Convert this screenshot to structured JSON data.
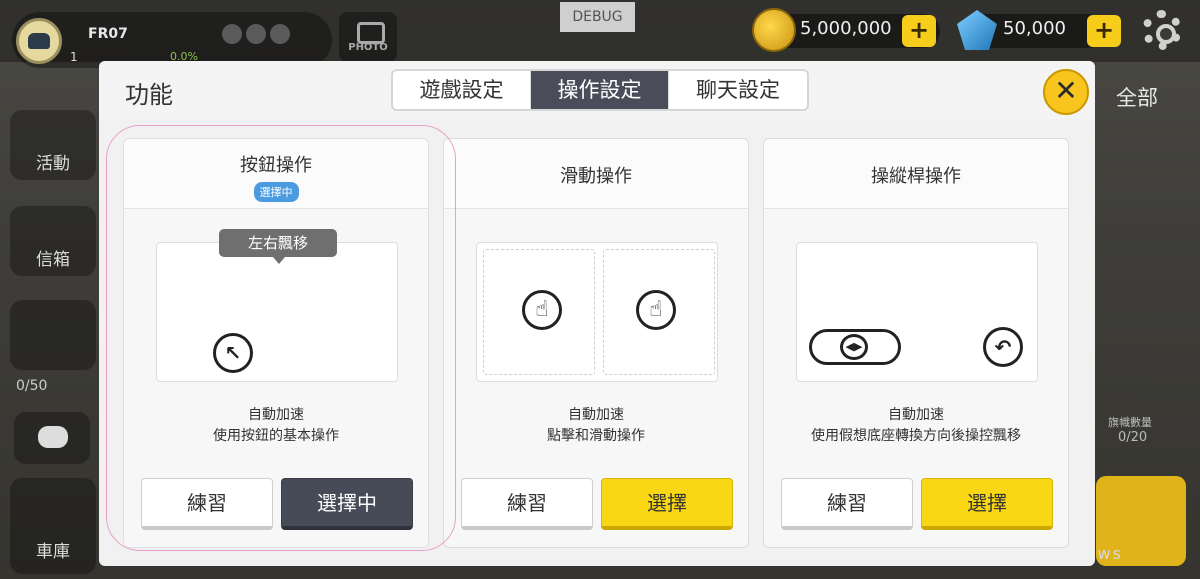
{
  "hud": {
    "player_name": "FR07",
    "level": "1",
    "exp_percent": "0.0%",
    "photo_label": "PHOTO",
    "debug_label": "DEBUG",
    "coins": "5,000,000",
    "gems": "50,000",
    "plus_symbol": "+"
  },
  "sidebar": {
    "items": [
      {
        "label": "活動"
      },
      {
        "label": "信箱"
      }
    ],
    "trophy_count": "0/50",
    "garage_label": "車庫"
  },
  "right_panel": {
    "all_label": "全部",
    "flag_label": "旗幟數量",
    "flag_count": "0/20"
  },
  "watermark": "us news",
  "modal": {
    "title": "功能",
    "tabs": [
      {
        "label": "遊戲設定",
        "active": false
      },
      {
        "label": "操作設定",
        "active": true
      },
      {
        "label": "聊天設定",
        "active": false
      }
    ],
    "close_symbol": "✕",
    "cards": [
      {
        "title": "按鈕操作",
        "badge": "選擇中",
        "tooltip": "左右飄移",
        "desc_line1": "自動加速",
        "desc_line2": "使用按鈕的基本操作",
        "practice_label": "練習",
        "select_label": "選擇中"
      },
      {
        "title": "滑動操作",
        "desc_line1": "自動加速",
        "desc_line2": "點擊和滑動操作",
        "practice_label": "練習",
        "select_label": "選擇"
      },
      {
        "title": "操縱桿操作",
        "desc_line1": "自動加速",
        "desc_line2": "使用假想底座轉換方向後操控飄移",
        "practice_label": "練習",
        "select_label": "選擇"
      }
    ]
  },
  "colors": {
    "accent_yellow": "#f9d714",
    "selected_dark": "#474a57",
    "badge_blue": "#4a9be0"
  }
}
